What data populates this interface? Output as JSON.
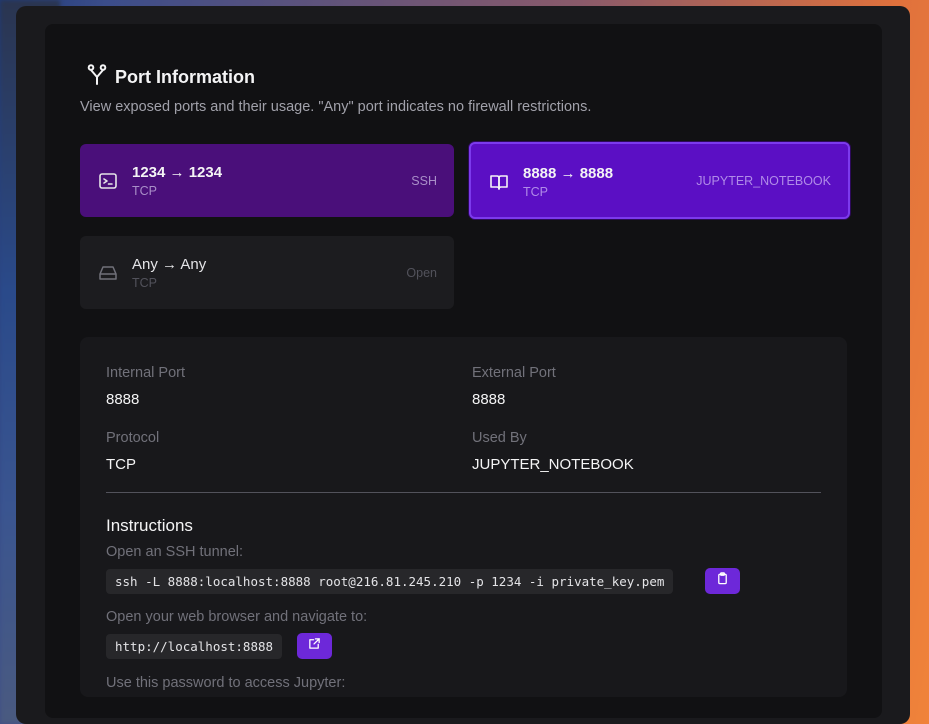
{
  "header": {
    "title": "Port Information",
    "subtitle": "View exposed ports and their usage. \"Any\" port indicates no firewall restrictions."
  },
  "ports": [
    {
      "mapping": "1234 → 1234",
      "protocol": "TCP",
      "used_by": "SSH",
      "icon": "terminal-icon",
      "selected": false
    },
    {
      "mapping": "8888 → 8888",
      "protocol": "TCP",
      "used_by": "JUPYTER_NOTEBOOK",
      "icon": "book-icon",
      "selected": true
    },
    {
      "mapping": "Any → Any",
      "protocol": "TCP",
      "used_by": "Open",
      "icon": "hard-drive-icon",
      "selected": false
    }
  ],
  "details": {
    "internal_port_label": "Internal Port",
    "internal_port": "8888",
    "external_port_label": "External Port",
    "external_port": "8888",
    "protocol_label": "Protocol",
    "protocol": "TCP",
    "used_by_label": "Used By",
    "used_by": "JUPYTER_NOTEBOOK"
  },
  "instructions": {
    "title": "Instructions",
    "ssh_label": "Open an SSH tunnel:",
    "ssh_command": "ssh -L 8888:localhost:8888 root@216.81.245.210 -p 1234 -i private_key.pem",
    "browser_label": "Open your web browser and navigate to:",
    "url": "http://localhost:8888",
    "password_label": "Use this password to access Jupyter:"
  },
  "colors": {
    "accent": "#6d28d9",
    "selected_card": "#5b0fc4",
    "ssh_card": "#4a0f7a"
  },
  "icons": {
    "title": "fork-icon",
    "copy": "clipboard-icon",
    "open": "external-link-icon"
  }
}
